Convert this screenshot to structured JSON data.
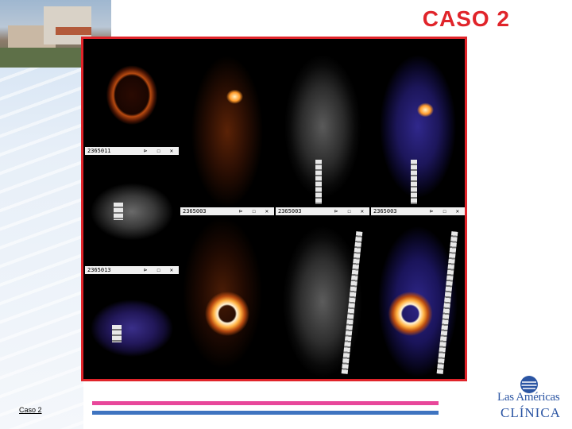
{
  "slide": {
    "title": "CASO 2",
    "footer_label": "Caso 2",
    "colors": {
      "title": "#e0242a",
      "frame": "#e0242a",
      "line_pink": "#e8479a",
      "line_blue": "#3f74c0",
      "logo": "#2b55a3"
    }
  },
  "viewer": {
    "panels": [
      {
        "id": "pet-axial",
        "header": ""
      },
      {
        "id": "ct-axial",
        "header": "2365011",
        "controls": "⊳ ☐ ✕"
      },
      {
        "id": "fused-axial",
        "header": "2365013",
        "controls": "⊳ ☐ ✕"
      },
      {
        "id": "pet-coronal",
        "header": ""
      },
      {
        "id": "ct-coronal",
        "header": ""
      },
      {
        "id": "fused-coronal",
        "header": ""
      },
      {
        "id": "pet-sagittal",
        "header": "2365003",
        "controls": "⊳ ☐ ✕"
      },
      {
        "id": "ct-sagittal",
        "header": "2365003",
        "controls": "⊳ ☐ ✕"
      },
      {
        "id": "fused-sagittal",
        "header": "2365003",
        "controls": "⊳ ☐ ✕"
      }
    ]
  },
  "logo": {
    "line1": "Las Américas",
    "line2": "CLÍNICA",
    "mark_icon": "globe-logo-icon"
  },
  "header_photo_icon": "building-photo"
}
